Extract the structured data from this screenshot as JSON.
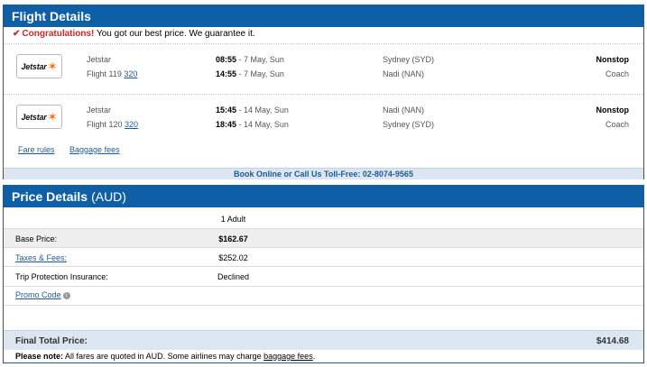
{
  "flight_details": {
    "title": "Flight Details",
    "congrats_strong": "Congratulations!",
    "congrats_text": " You got our best price. We guarantee it.",
    "flights": [
      {
        "airline": "Jetstar",
        "flight_prefix": "Flight 119",
        "aircraft": "320",
        "depart_time": "08:55",
        "depart_date": " - 7 May, Sun",
        "arrive_time": "14:55",
        "arrive_date": " - 7 May, Sun",
        "from_city": "Sydney (SYD)",
        "to_city": "Nadi (NAN)",
        "stops": "Nonstop",
        "cabin": "Coach"
      },
      {
        "airline": "Jetstar",
        "flight_prefix": "Flight 120",
        "aircraft": "320",
        "depart_time": "15:45",
        "depart_date": " - 14 May, Sun",
        "arrive_time": "18:45",
        "arrive_date": " - 14 May, Sun",
        "from_city": "Nadi (NAN)",
        "to_city": "Sydney (SYD)",
        "stops": "Nonstop",
        "cabin": "Coach"
      }
    ],
    "fare_rules": "Fare rules",
    "baggage_fees": "Baggage fees",
    "tollfree": "Book Online or Call Us Toll-Free: 02-8074-9565",
    "logo_text": "Jetstar"
  },
  "price_details": {
    "title": "Price Details",
    "currency": "(AUD)",
    "passengers": "1 Adult",
    "base_label": "Base Price:",
    "base_value": "$162.67",
    "taxes_label": "Taxes & Fees:",
    "taxes_value": "$252.02",
    "insurance_label": "Trip Protection Insurance:",
    "insurance_value": "Declined",
    "promo_label": "Promo Code",
    "final_label": "Final Total Price:",
    "final_value": "$414.68",
    "note_bold": "Please note:",
    "note_text": " All fares are quoted in AUD. Some airlines may charge ",
    "note_link": "baggage fees",
    "note_end": "."
  },
  "colors": {
    "header_blue": "#0f5fa6",
    "accent_red": "#cc2a2a",
    "jetstar_orange": "#ff6a00",
    "light_band": "#dce6f0"
  }
}
